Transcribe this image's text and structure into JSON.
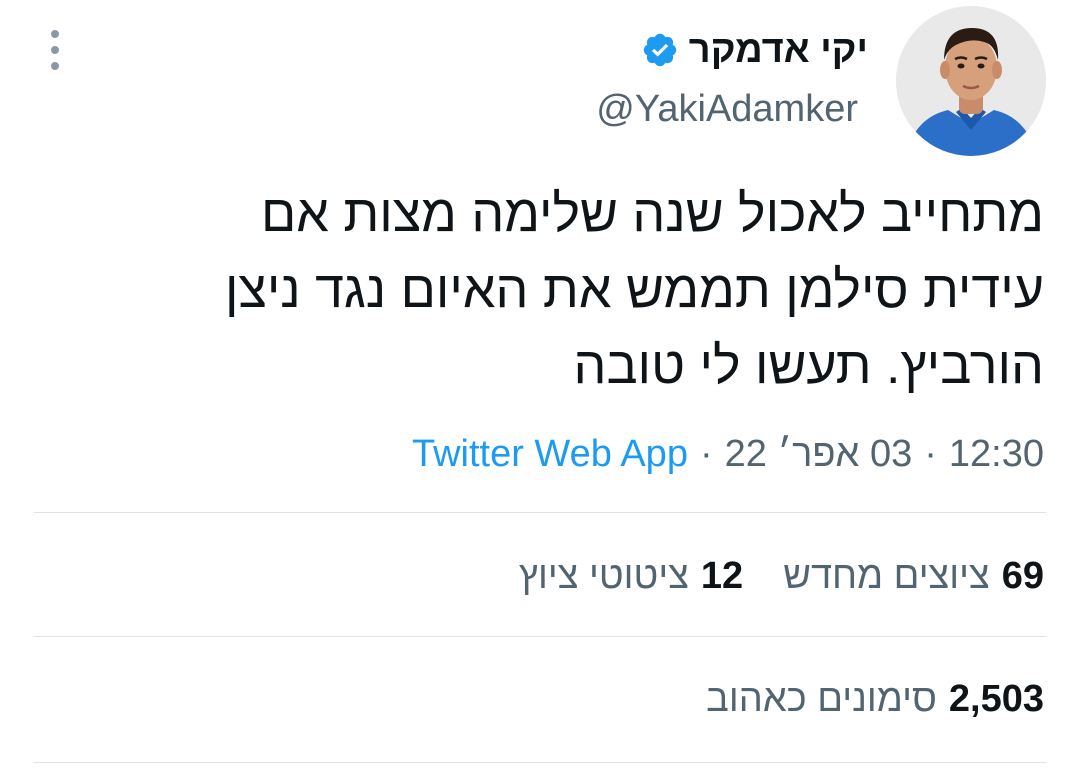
{
  "author": {
    "display_name": "יקי אדמקר",
    "handle": "@YakiAdamker",
    "verified_icon": "verified-badge-icon",
    "avatar": "profile-photo"
  },
  "tweet": {
    "text": "מתחייב לאכול שנה שלימה מצות אם\nעידית סילמן תממש את האיום נגד ניצן\nהורביץ. תעשו לי טובה"
  },
  "meta": {
    "time": "12:30",
    "separator": "·",
    "date": "03 אפר׳ 22",
    "app": "Twitter Web App"
  },
  "stats": {
    "retweets": {
      "count": "69",
      "label": "ציוצים מחדש"
    },
    "quotes": {
      "count": "12",
      "label": "ציטוטי ציוץ"
    },
    "likes": {
      "count": "2,503",
      "label": "סימונים כאהוב"
    }
  },
  "colors": {
    "accent": "#1d9bf0",
    "text": "#0f1419",
    "secondary": "#536471",
    "divider": "#dfe3e6"
  }
}
